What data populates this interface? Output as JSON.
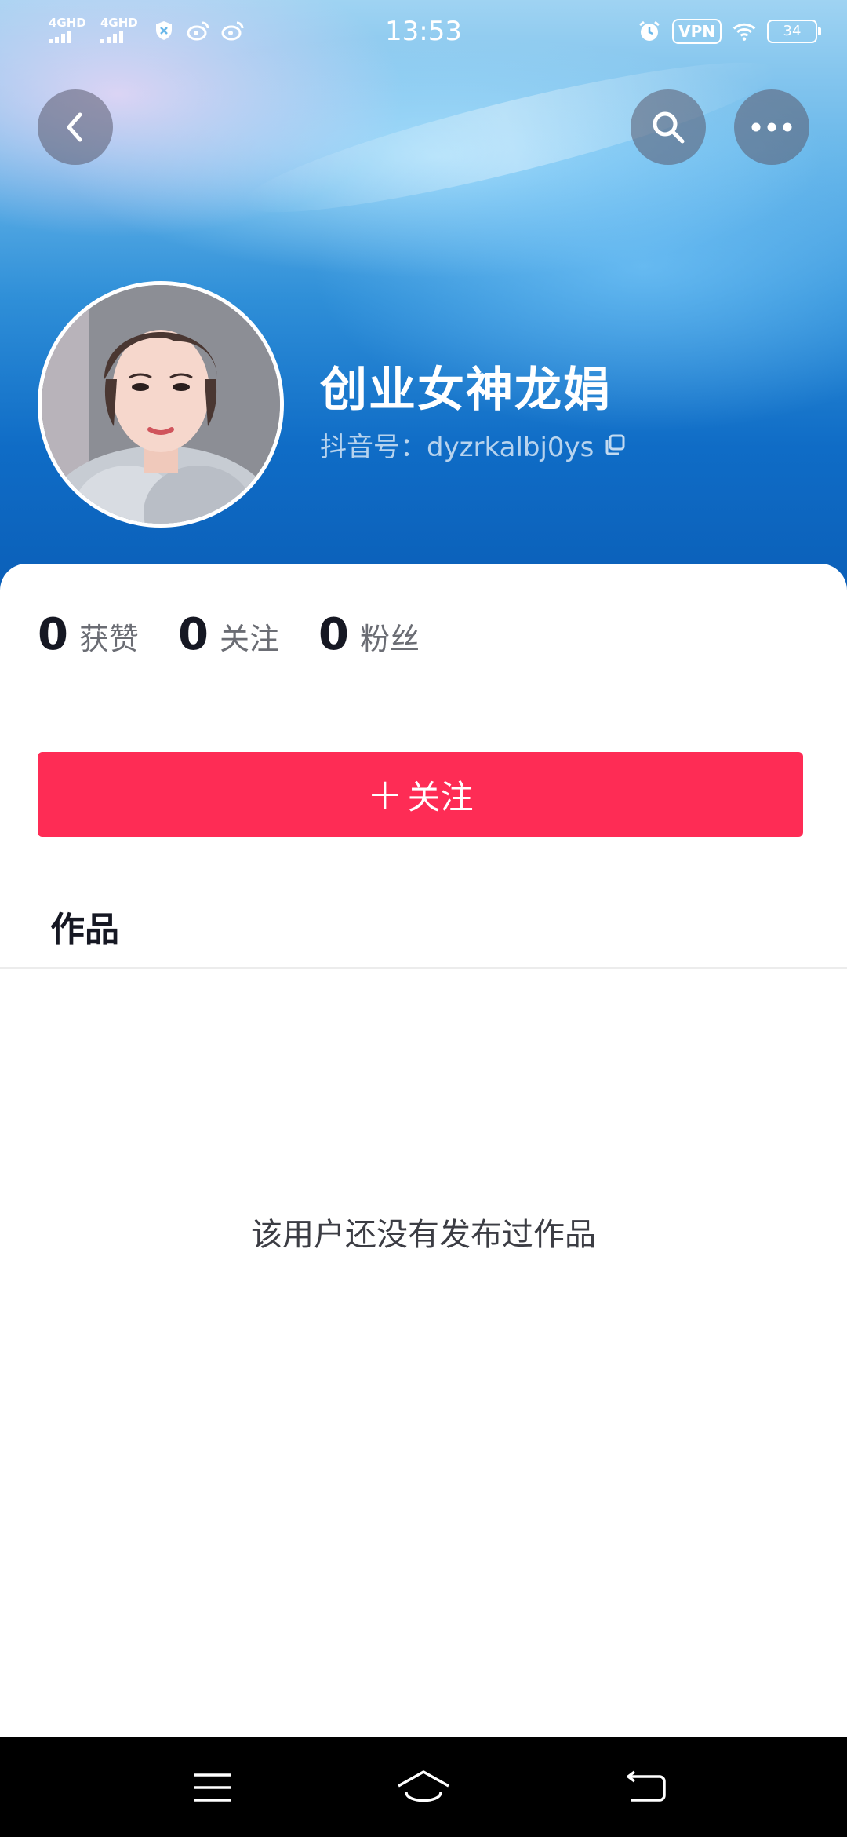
{
  "status_bar": {
    "time": "13:53",
    "signal_1_label": "4GHD",
    "signal_2_label": "4GHD",
    "vpn_label": "VPN",
    "battery_level": "34",
    "icons_left": [
      "signal-icon",
      "signal-icon",
      "shield-icon",
      "weibo-icon",
      "weibo-icon"
    ],
    "icons_right": [
      "alarm-icon",
      "vpn-badge",
      "wifi-icon",
      "battery-icon"
    ]
  },
  "header": {
    "back_icon": "back-arrow-icon",
    "search_icon": "search-icon",
    "more_icon": "more-icon"
  },
  "profile": {
    "name": "创业女神龙娟",
    "douyin_id": "抖音号：dyzrkalbj0ys",
    "copy_icon": "copy-icon"
  },
  "stats": [
    {
      "num": "0",
      "label": "获赞"
    },
    {
      "num": "0",
      "label": "关注"
    },
    {
      "num": "0",
      "label": "粉丝"
    }
  ],
  "follow_button": {
    "plus": "+",
    "label": "关注"
  },
  "tabs": {
    "works": "作品"
  },
  "empty_state": "该用户还没有发布过作品",
  "nav_bar": [
    "menu-icon",
    "home-icon",
    "back-icon"
  ],
  "colors": {
    "accent": "#fe2c55",
    "header_blue": "#0b5fb8"
  }
}
